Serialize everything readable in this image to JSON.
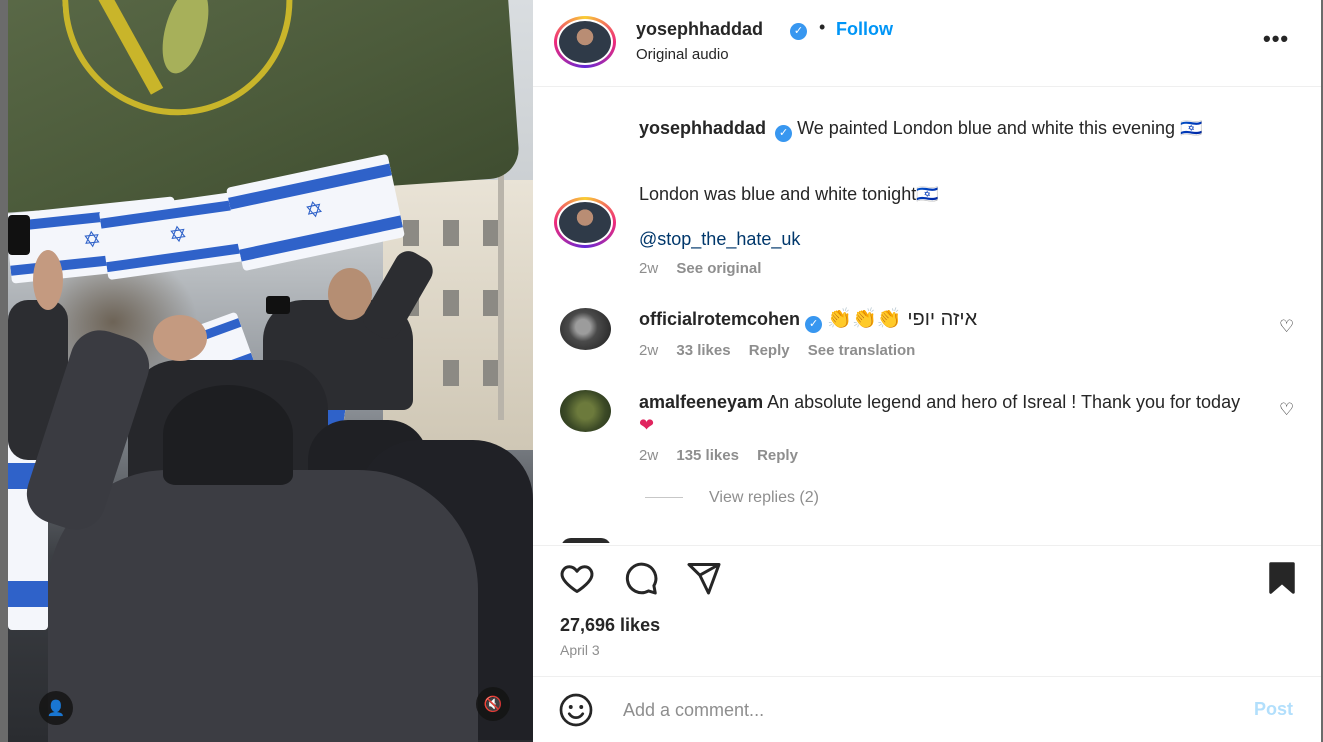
{
  "post": {
    "author": "yosephhaddad",
    "follow_label": "Follow",
    "dot": "•",
    "audio": "Original audio",
    "more_label": "•••",
    "verified_glyph": "✓"
  },
  "caption": {
    "author": "yosephhaddad",
    "text": "We painted London blue and white this evening 🇮🇱",
    "text2": "London was blue and white tonight🇮🇱",
    "mention": "@stop_the_hate_uk",
    "time": "2w",
    "see_original": "See original"
  },
  "comments": [
    {
      "user": "officialrotemcohen",
      "verified": true,
      "text": "👏👏👏 איזה יופי",
      "time": "2w",
      "likes": "33 likes",
      "reply": "Reply",
      "translate": "See translation",
      "heart": "♡"
    },
    {
      "user": "amalfeeneyam",
      "verified": false,
      "text": "An absolute legend and hero of Isreal ! Thank you for today",
      "emoji": "❤",
      "time": "2w",
      "likes": "135 likes",
      "reply": "Reply",
      "heart": "♡",
      "view_replies": "View replies (2)"
    }
  ],
  "actions": {
    "icons": [
      "heart-icon",
      "comment-icon",
      "share-icon",
      "bookmark-icon"
    ],
    "likes": "27,696 likes",
    "date": "April 3"
  },
  "add_comment": {
    "placeholder": "Add a comment...",
    "post_label": "Post"
  },
  "media": {
    "user_icon": "👤",
    "mute_icon": "🔇"
  },
  "colors": {
    "accent": "#0095f6",
    "verified": "#3897f0",
    "heart_red": "#e0245e",
    "post_disabled": "#b2dffc"
  }
}
